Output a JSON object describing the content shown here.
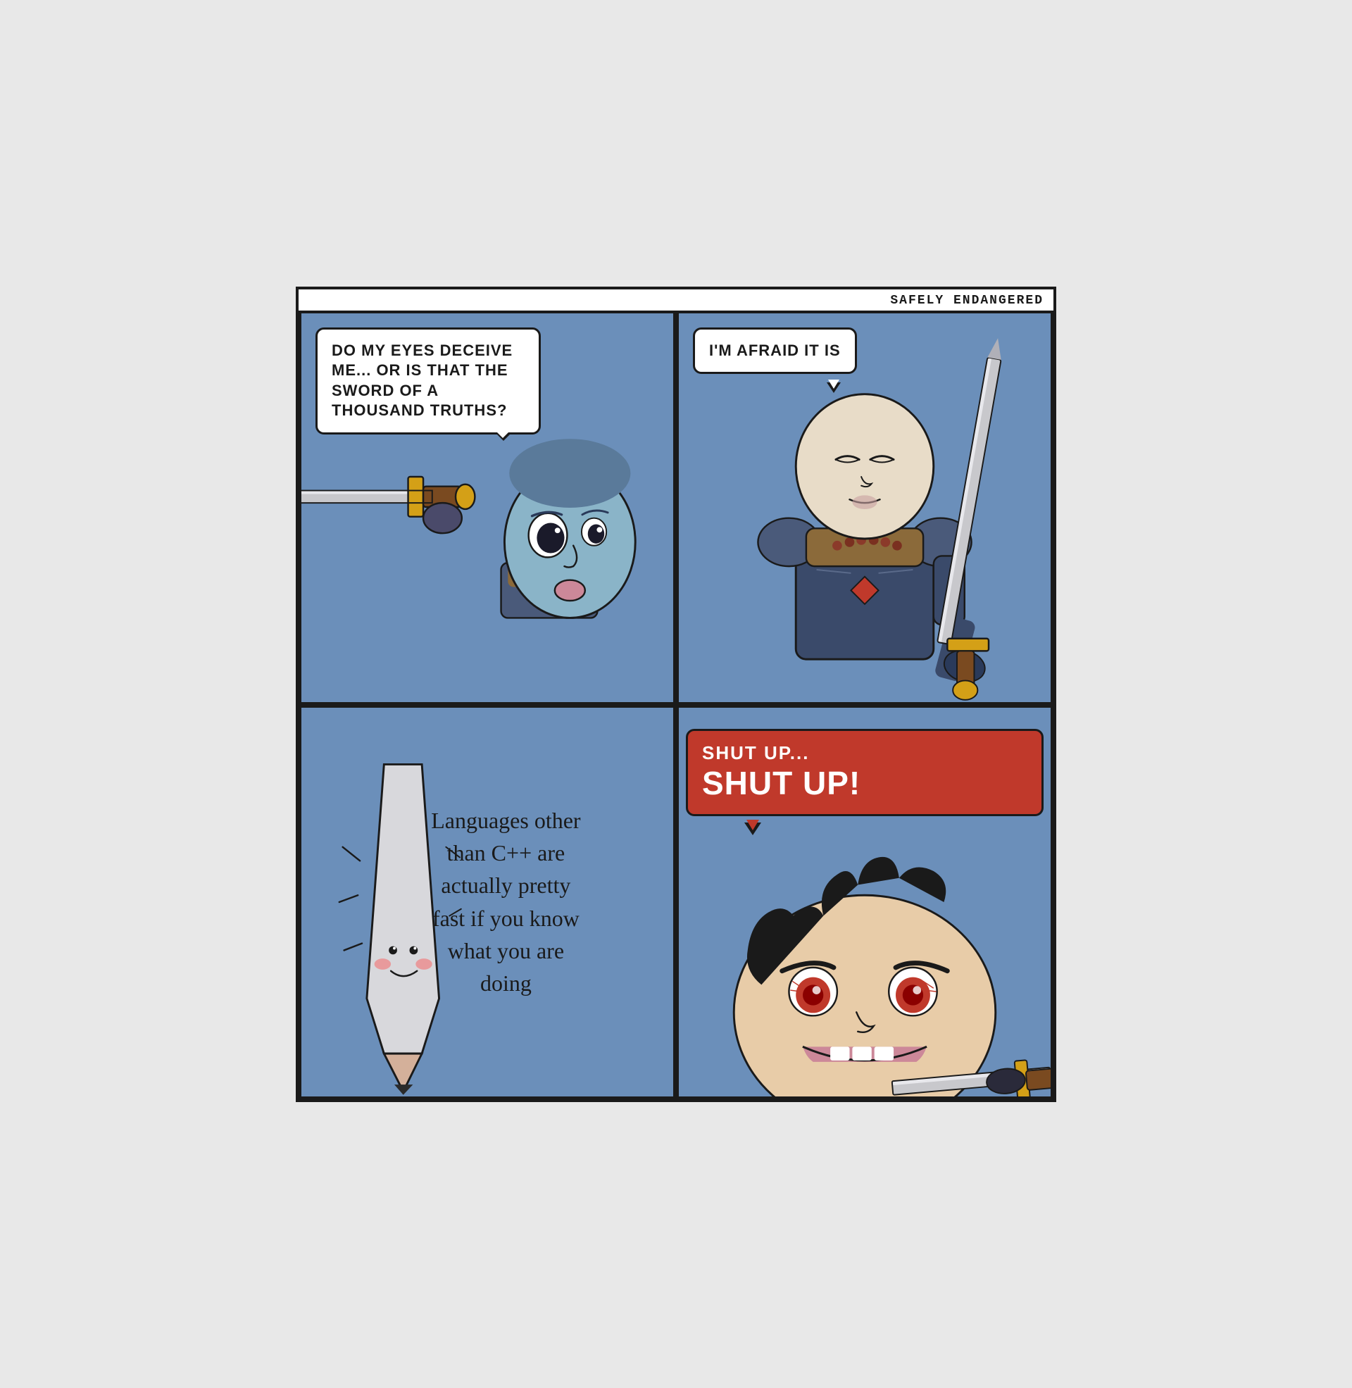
{
  "title": "SAFELY ENDANGERED",
  "panel1": {
    "speech": "DO MY EYES DECEIVE ME... OR IS THAT THE SWORD OF A THOUSAND TRUTHS?"
  },
  "panel2": {
    "speech": "I'M AFRAID IT IS"
  },
  "panel3": {
    "text": "Languages other than C++ are actually pretty fast if you know what you are doing"
  },
  "panel4": {
    "speech_line1": "SHUT UP...",
    "speech_line2": "SHUT UP!"
  }
}
